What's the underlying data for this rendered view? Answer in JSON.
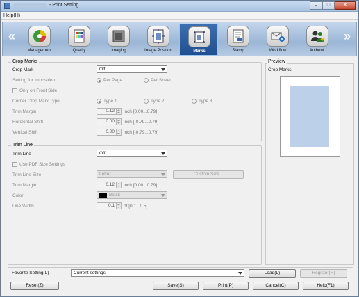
{
  "window": {
    "title": "- Print Setting",
    "controls": [
      "–",
      "□",
      "✕"
    ]
  },
  "menu": {
    "help": "Help(H)"
  },
  "toolbar": {
    "prev_arrow": "«",
    "next_arrow": "»",
    "items": [
      {
        "label": "Management",
        "icon": "management-icon"
      },
      {
        "label": "Quality",
        "icon": "quality-icon"
      },
      {
        "label": "Imaging",
        "icon": "imaging-icon"
      },
      {
        "label": "Image Position",
        "icon": "image-position-icon"
      },
      {
        "label": "Marks",
        "icon": "marks-icon",
        "active": true
      },
      {
        "label": "Stamp",
        "icon": "stamp-icon"
      },
      {
        "label": "Workflow",
        "icon": "workflow-icon"
      },
      {
        "label": "Authent.",
        "icon": "authentication-icon"
      }
    ]
  },
  "crop_marks": {
    "group_title": "Crop Marks",
    "crop_mark_label": "Crop Mark",
    "crop_mark_value": "Off",
    "imposition_label": "Setting for Imposition",
    "per_page": "Per Page",
    "per_sheet": "Per Sheet",
    "front_side_only": "Only on Front Side",
    "corner_type_label": "Corner Crop Mark Type",
    "type1": "Type 1",
    "type2": "Type 2",
    "type3": "Type 3",
    "trim_margin_label": "Trim Margin",
    "trim_margin_value": "0.12",
    "trim_margin_unit": "inch [0.00...0.79]",
    "h_shift_label": "Horizontal Shift",
    "h_shift_value": "0.00",
    "h_shift_unit": "inch [-0.79...0.79]",
    "v_shift_label": "Vertical Shift",
    "v_shift_value": "0.00",
    "v_shift_unit": "inch [-0.79...0.79]"
  },
  "trim_line": {
    "group_title": "Trim Line",
    "trim_line_label": "Trim Line",
    "trim_line_value": "Off",
    "use_pdf_size": "Use PDF Size Settings",
    "size_label": "Trim Line Size",
    "size_value": "Letter",
    "custom_size_button": "Custom Size...",
    "margin_label": "Trim Margin",
    "margin_value": "0.12",
    "margin_unit": "inch [0.00...0.79]",
    "color_label": "Color",
    "color_value": "Black",
    "width_label": "Line Width",
    "width_value": "0.1",
    "width_unit": "pt [0.1...0.5]"
  },
  "preview": {
    "title": "Preview",
    "subtitle": "Crop Marks"
  },
  "favorite": {
    "label": "Favorite Setting(L)",
    "value": "Current settings",
    "load": "Load(L)",
    "register": "Register(R)"
  },
  "footer": {
    "reset": "Reset(Z)",
    "save": "Save(S)",
    "print": "Print(P)",
    "cancel": "Cancel(C)",
    "help": "Help(F1)"
  }
}
